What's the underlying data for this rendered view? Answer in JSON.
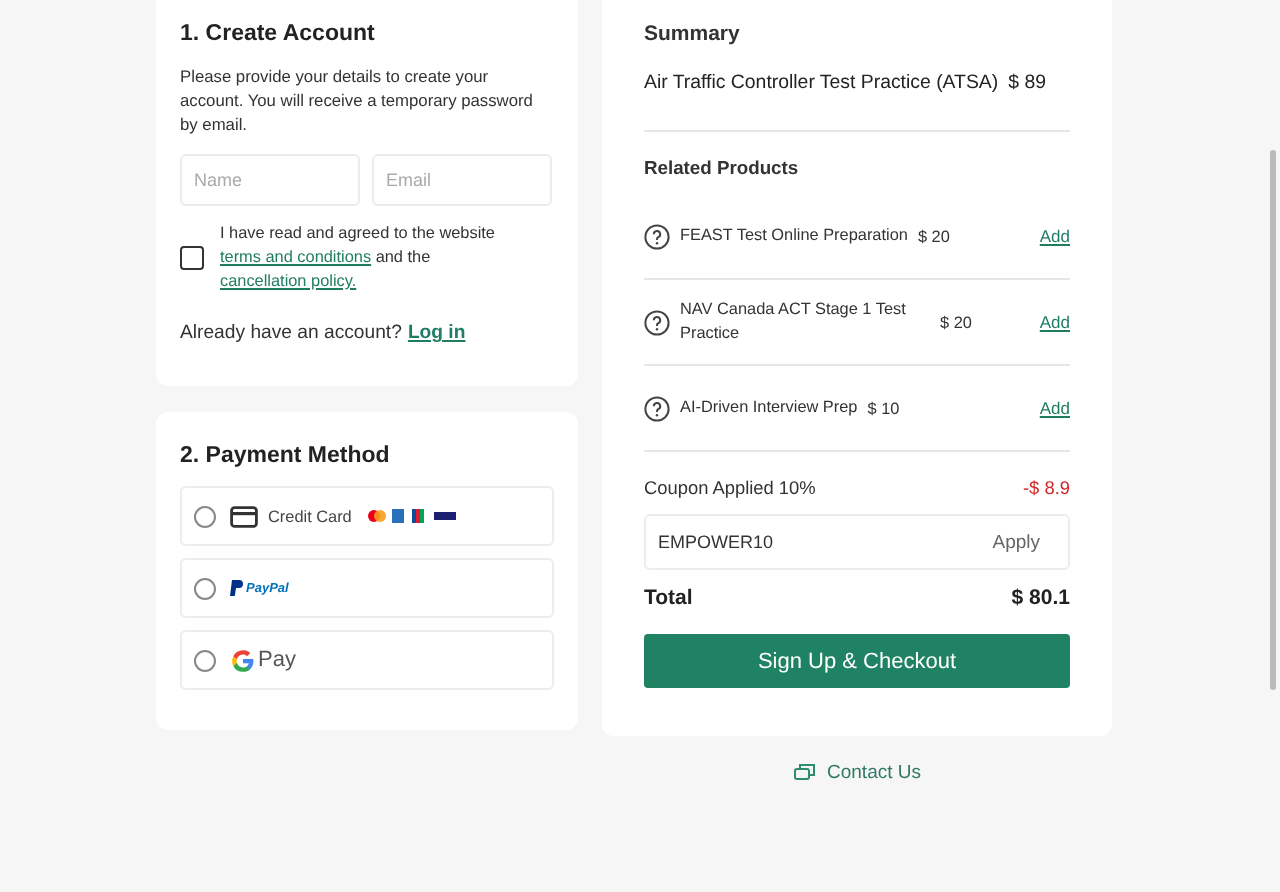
{
  "account": {
    "title": "1. Create Account",
    "intro": "Please provide your details to create your account. You will receive a temporary password by email.",
    "name_field": {
      "placeholder": "Name"
    },
    "email_field": {
      "placeholder": "Email"
    },
    "agreement": {
      "checked": false,
      "before": "I have read and agreed to the website",
      "link1": "terms and conditions",
      "middle": "and the",
      "link2": "cancellation policy."
    },
    "login_prompt": "Already have an account?",
    "login_link": "Log in"
  },
  "payment": {
    "title": "2. Payment Method",
    "options": [
      {
        "kind": "card",
        "label": "Credit Card",
        "selected": false
      },
      {
        "kind": "paypal",
        "label": "PayPal",
        "selected": false
      },
      {
        "kind": "gpay",
        "label": "Pay",
        "selected": false
      }
    ]
  },
  "summary": {
    "title": "Summary",
    "product": "Air Traffic Controller Test Practice (ATSA)",
    "price": "$ 89",
    "related_title": "Related Products",
    "related": [
      {
        "name": "FEAST Test Online Preparation",
        "price": "$ 20",
        "action": "Add"
      },
      {
        "name": "NAV Canada ACT Stage 1 Test Practice",
        "price": "$ 20",
        "action": "Add"
      },
      {
        "name": "AI-Driven Interview Prep",
        "price": "$ 10",
        "action": "Add"
      }
    ],
    "coupon_label": "Coupon Applied 10%",
    "coupon_discount": "-$ 8.9",
    "coupon_code": "EMPOWER10",
    "apply": "Apply",
    "total_label": "Total",
    "total": "$ 80.1",
    "checkout": "Sign Up & Checkout"
  },
  "contact": "Contact Us"
}
